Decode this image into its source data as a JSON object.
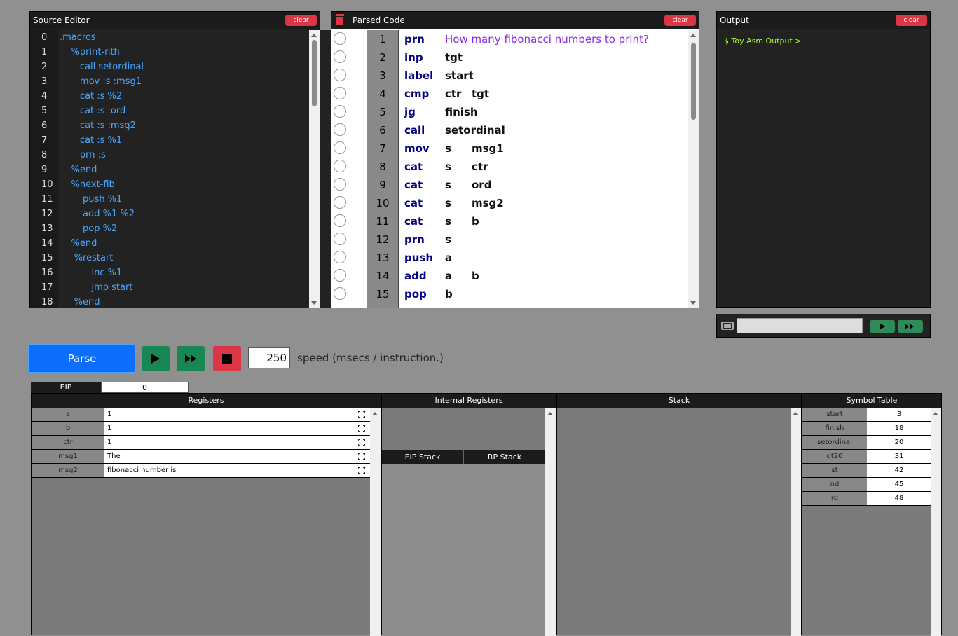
{
  "source_editor": {
    "title": "Source Editor",
    "clear_label": "clear",
    "line_numbers": [
      "0",
      "1",
      "2",
      "3",
      "4",
      "5",
      "6",
      "7",
      "8",
      "9",
      "10",
      "11",
      "12",
      "13",
      "14",
      "15",
      "16",
      "17",
      "18"
    ],
    "lines": [
      ".macros",
      "    %print-nth",
      "       call setordinal",
      "       mov :s :msg1",
      "       cat :s %2",
      "       cat :s :ord",
      "       cat :s :msg2",
      "       cat :s %1",
      "       prn :s",
      "    %end",
      "    %next-fib",
      "        push %1",
      "        add %1 %2",
      "        pop %2",
      "    %end",
      "     %restart",
      "           inc %1",
      "           jmp start",
      "     %end"
    ]
  },
  "parsed_code": {
    "title": "Parsed Code",
    "clear_label": "clear",
    "trash_icon": "trash-icon",
    "rows": [
      {
        "n": "1",
        "op": "prn",
        "a1": "How many fibonacci numbers to print?",
        "a2": "",
        "is_string": true
      },
      {
        "n": "2",
        "op": "inp",
        "a1": "tgt",
        "a2": ""
      },
      {
        "n": "3",
        "op": "label",
        "a1": "start",
        "a2": ""
      },
      {
        "n": "4",
        "op": "cmp",
        "a1": "ctr",
        "a2": "tgt"
      },
      {
        "n": "5",
        "op": "jg",
        "a1": "finish",
        "a2": ""
      },
      {
        "n": "6",
        "op": "call",
        "a1": "setordinal",
        "a2": ""
      },
      {
        "n": "7",
        "op": "mov",
        "a1": "s",
        "a2": "msg1"
      },
      {
        "n": "8",
        "op": "cat",
        "a1": "s",
        "a2": "ctr"
      },
      {
        "n": "9",
        "op": "cat",
        "a1": "s",
        "a2": "ord"
      },
      {
        "n": "10",
        "op": "cat",
        "a1": "s",
        "a2": "msg2"
      },
      {
        "n": "11",
        "op": "cat",
        "a1": "s",
        "a2": "b"
      },
      {
        "n": "12",
        "op": "prn",
        "a1": "s",
        "a2": ""
      },
      {
        "n": "13",
        "op": "push",
        "a1": "a",
        "a2": ""
      },
      {
        "n": "14",
        "op": "add",
        "a1": "a",
        "a2": "b"
      },
      {
        "n": "15",
        "op": "pop",
        "a1": "b",
        "a2": ""
      }
    ]
  },
  "output": {
    "title": "Output",
    "clear_label": "clear",
    "prompt": "$ Toy Asm Output >"
  },
  "input_bar": {
    "keyboard_icon": "keyboard-icon",
    "value": ""
  },
  "controls": {
    "parse_label": "Parse",
    "speed_value": "250",
    "speed_label": "speed (msecs / instruction.)",
    "colors": {
      "parse": "#0d6efd",
      "run": "#198754",
      "stop": "#dc3545"
    }
  },
  "eip": {
    "label": "EIP",
    "value": "0"
  },
  "registers": {
    "title": "Registers",
    "rows": [
      {
        "name": "a",
        "value": "1"
      },
      {
        "name": "b",
        "value": "1"
      },
      {
        "name": "ctr",
        "value": "1"
      },
      {
        "name": "msg1",
        "value": "The"
      },
      {
        "name": "msg2",
        "value": "fibonacci number is"
      }
    ]
  },
  "internal_registers": {
    "title": "Internal Registers",
    "eip_stack": "EIP Stack",
    "rp_stack": "RP Stack"
  },
  "stack": {
    "title": "Stack"
  },
  "symbol_table": {
    "title": "Symbol Table",
    "rows": [
      {
        "name": "start",
        "value": "3"
      },
      {
        "name": "finish",
        "value": "18"
      },
      {
        "name": "setordinal",
        "value": "20"
      },
      {
        "name": "gt20",
        "value": "31"
      },
      {
        "name": "st",
        "value": "42"
      },
      {
        "name": "nd",
        "value": "45"
      },
      {
        "name": "rd",
        "value": "48"
      }
    ]
  }
}
